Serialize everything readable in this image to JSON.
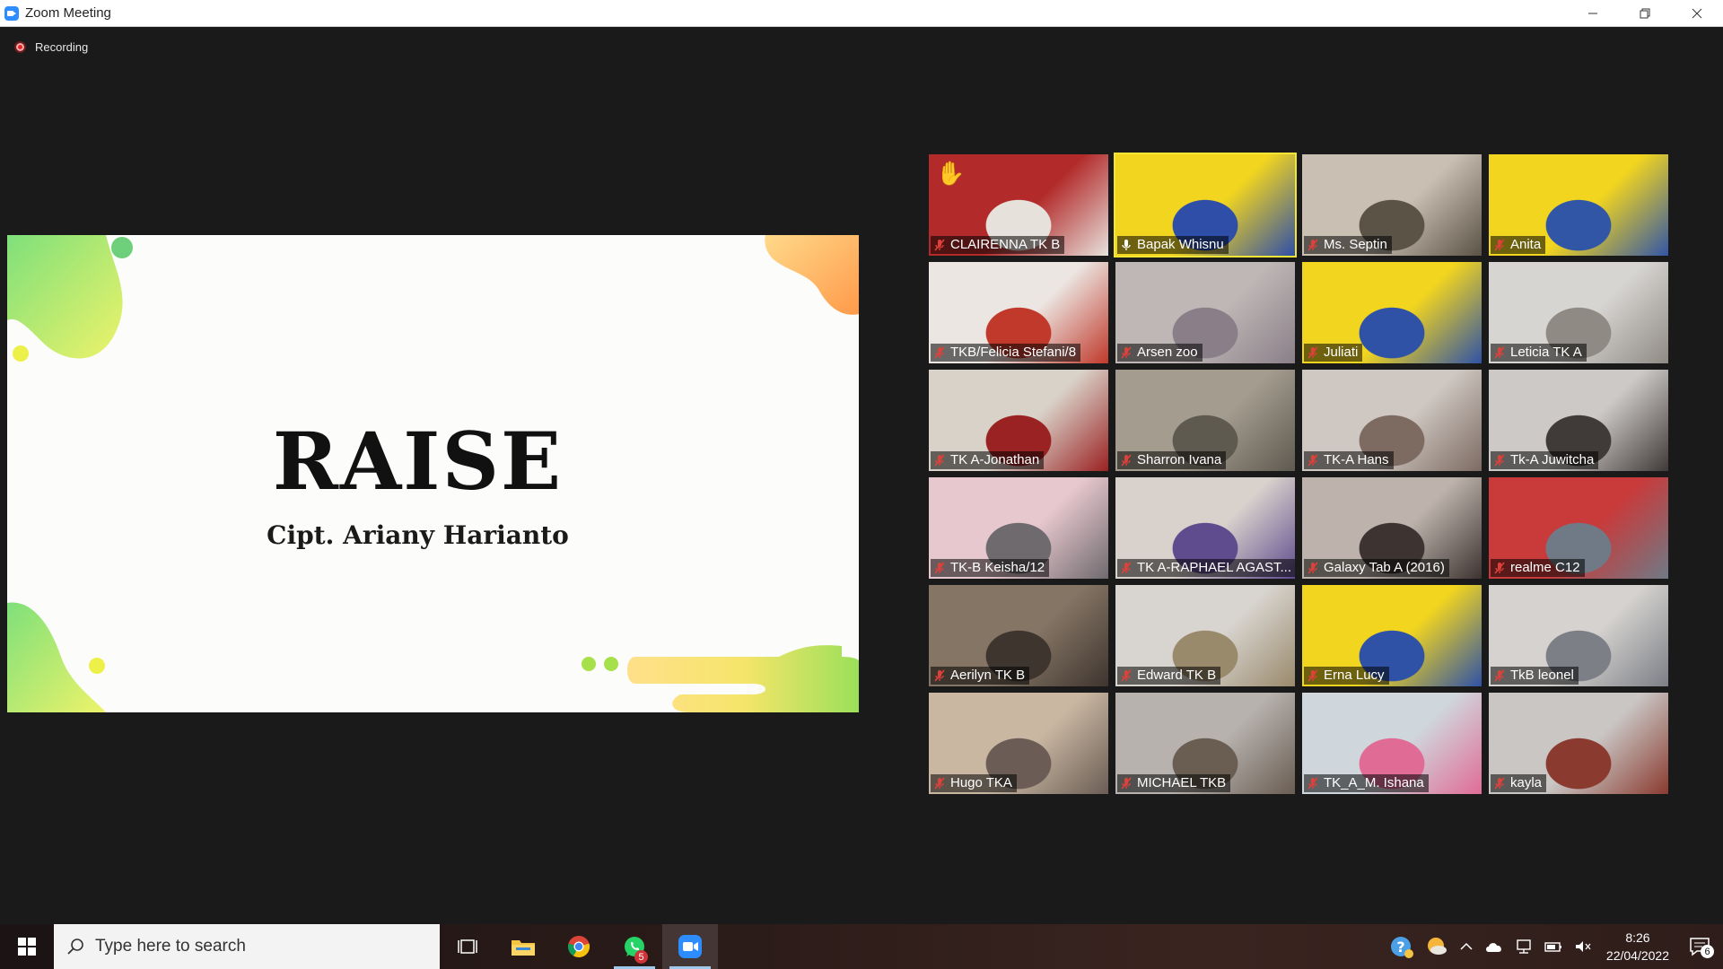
{
  "window": {
    "title": "Zoom Meeting",
    "controls": [
      "minimize",
      "restore",
      "close"
    ]
  },
  "recording": {
    "label": "Recording"
  },
  "share": {
    "title": "RAISE",
    "subtitle": "Cipt. Ariany Harianto"
  },
  "participants": [
    {
      "name": "CLAIRENNA TK B",
      "muted": true,
      "hand_raised": true,
      "bg": [
        "#b22a2a",
        "#e7e1dc"
      ]
    },
    {
      "name": "Bapak Whisnu",
      "muted": false,
      "active_speaker": true,
      "bg": [
        "#f2d51f",
        "#2e4ea8"
      ]
    },
    {
      "name": "Ms. Septin",
      "muted": true,
      "bg": [
        "#c9bfb2",
        "#5c5347"
      ]
    },
    {
      "name": "Anita",
      "muted": true,
      "bg": [
        "#f2d51f",
        "#3256a6"
      ]
    },
    {
      "name": "TKB/Felicia Stefani/8",
      "muted": true,
      "bg": [
        "#ece6e2",
        "#c0392b"
      ]
    },
    {
      "name": "Arsen zoo",
      "muted": true,
      "bg": [
        "#bfb7b6",
        "#8a7f88"
      ]
    },
    {
      "name": "Juliati",
      "muted": true,
      "bg": [
        "#f2d51f",
        "#2f52a6"
      ]
    },
    {
      "name": "Leticia TK A",
      "muted": true,
      "bg": [
        "#d7d5d2",
        "#8f8a84"
      ]
    },
    {
      "name": "TK A-Jonathan",
      "muted": true,
      "bg": [
        "#d9d2c9",
        "#9b2222"
      ]
    },
    {
      "name": "Sharron Ivana",
      "muted": true,
      "bg": [
        "#a49c8f",
        "#5f5a50"
      ]
    },
    {
      "name": "TK-A Hans",
      "muted": true,
      "bg": [
        "#cfc8c2",
        "#7d6b62"
      ]
    },
    {
      "name": "Tk-A Juwitcha",
      "muted": true,
      "bg": [
        "#cdc9c6",
        "#403a38"
      ]
    },
    {
      "name": "TK-B Keisha/12",
      "muted": true,
      "bg": [
        "#e8c8cf",
        "#6f6a6e"
      ]
    },
    {
      "name": "TK A-RAPHAEL AGAST...",
      "muted": true,
      "bg": [
        "#d9d2cc",
        "#5e4c8e"
      ]
    },
    {
      "name": "Galaxy Tab A (2016)",
      "muted": true,
      "bg": [
        "#bdb3ac",
        "#3d3431"
      ]
    },
    {
      "name": "realme C12",
      "muted": true,
      "bg": [
        "#c93a3a",
        "#6f7a86"
      ]
    },
    {
      "name": "Aerilyn TK B",
      "muted": true,
      "bg": [
        "#857565",
        "#3f352f"
      ]
    },
    {
      "name": "Edward TK B",
      "muted": true,
      "bg": [
        "#d8d4cf",
        "#9a8a6c"
      ]
    },
    {
      "name": "Erna Lucy",
      "muted": true,
      "bg": [
        "#f2d51f",
        "#2f52a6"
      ]
    },
    {
      "name": "TkB leonel",
      "muted": true,
      "bg": [
        "#d5d2cf",
        "#7c7f86"
      ]
    },
    {
      "name": "Hugo TKA",
      "muted": true,
      "bg": [
        "#c9b7a2",
        "#6b5d55"
      ]
    },
    {
      "name": "MICHAEL TKB",
      "muted": true,
      "bg": [
        "#b7b2ae",
        "#6a5d52"
      ]
    },
    {
      "name": "TK_A_M. Ishana",
      "muted": true,
      "bg": [
        "#cfd7dc",
        "#e06c96"
      ]
    },
    {
      "name": "kayla",
      "muted": true,
      "bg": [
        "#c9c6c4",
        "#8a3a2f"
      ]
    }
  ],
  "taskbar": {
    "search_placeholder": "Type here to search",
    "apps": [
      {
        "name": "task-view",
        "icon": "task-view-icon"
      },
      {
        "name": "file-explorer",
        "icon": "folder-icon"
      },
      {
        "name": "chrome",
        "icon": "chrome-icon"
      },
      {
        "name": "whatsapp",
        "icon": "whatsapp-icon",
        "badge": "5"
      },
      {
        "name": "zoom",
        "icon": "zoom-icon",
        "active": true
      }
    ],
    "time": "8:26",
    "date": "22/04/2022",
    "notifications": "6"
  },
  "colors": {
    "accent": "#2d8cff",
    "active_speaker": "#f2e536",
    "muted_icon": "#e0403a"
  }
}
